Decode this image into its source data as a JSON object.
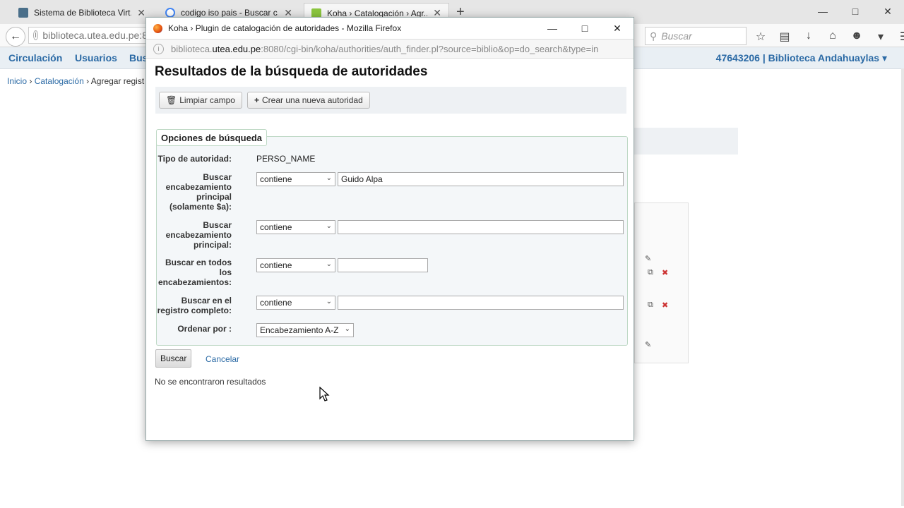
{
  "browser": {
    "tabs": [
      {
        "title": "Sistema de Biblioteca Virt...",
        "favicon": "shield-icon",
        "color": "#4a6f8a"
      },
      {
        "title": "codigo iso pais - Buscar c...",
        "favicon": "google-icon",
        "color": "#4285f4"
      },
      {
        "title": "Koha › Catalogación › Agr...",
        "favicon": "koha-icon",
        "color": "#8cc63f"
      }
    ],
    "url_partial": "biblioteca.utea.edu.pe:8",
    "search_placeholder": "Buscar",
    "close_symbol": "✕",
    "new_tab_symbol": "+"
  },
  "koha": {
    "nav": [
      "Circulación",
      "Usuarios",
      "Bus"
    ],
    "user_branch": "47643206 | Biblioteca Andahuaylas ▾",
    "breadcrumb": {
      "inicio": "Inicio",
      "sep": "›",
      "catalogacion": "Catalogación",
      "current": "Agregar regist"
    }
  },
  "popup": {
    "window_title": "Koha › Plugin de catalogación de autoridades - Mozilla Firefox",
    "url_host": "biblioteca.utea.edu.pe",
    "url_rest": ":8080/cgi-bin/koha/authorities/auth_finder.pl?source=biblio&op=do_search&type=in",
    "url_prefix": "biblioteca.",
    "url_domain": "utea.edu.pe",
    "heading": "Resultados de la búsqueda de autoridades",
    "buttons": {
      "clear": "Limpiar campo",
      "create": "Crear una nueva autoridad"
    },
    "legend": "Opciones de búsqueda",
    "fields": {
      "authority_type_label": "Tipo de autoridad:",
      "authority_type_value": "PERSO_NAME",
      "main_heading_a_label": "Buscar encabezamiento principal (solamente $a):",
      "main_heading_a_op": "contiene",
      "main_heading_a_value": "Guido Alpa",
      "main_heading_label": "Buscar encabezamiento principal:",
      "main_heading_op": "contiene",
      "main_heading_value": "",
      "all_headings_label": "Buscar en todos los encabezamientos:",
      "all_headings_op": "contiene",
      "all_headings_value": "",
      "full_record_label": "Buscar en el registro completo:",
      "full_record_op": "contiene",
      "full_record_value": "",
      "order_label": "Ordenar por :",
      "order_value": "Encabezamiento A-Z"
    },
    "submit": "Buscar",
    "cancel": "Cancelar",
    "no_results": "No se encontraron resultados"
  }
}
